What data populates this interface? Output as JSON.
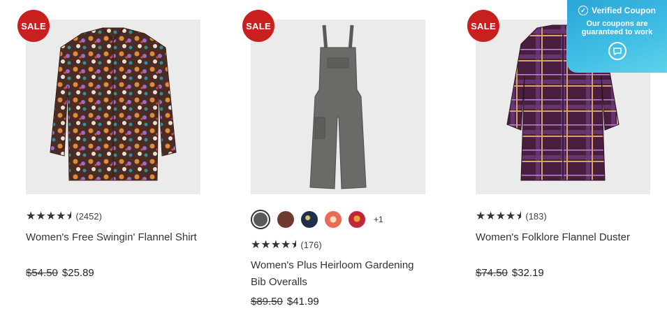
{
  "badges": {
    "sale": "SALE"
  },
  "products": [
    {
      "rating_count": "(2452)",
      "title": "Women's Free Swingin' Flannel Shirt",
      "old_price": "$54.50",
      "price": "$25.89"
    },
    {
      "rating_count": "(176)",
      "title_line1": "Women's Plus Heirloom Gardening",
      "title_line2": "Bib Overalls",
      "old_price": "$89.50",
      "price": "$41.99",
      "swatches": [
        "#5a5a58",
        "#6e3a2e",
        "#1f2f4a",
        "#e96b55",
        "#c0283a"
      ],
      "more_swatches": "+1"
    },
    {
      "rating_count": "(183)",
      "title": "Women's Folklore Flannel Duster",
      "old_price": "$74.50",
      "price": "$32.19"
    }
  ],
  "coupon": {
    "heading": "Verified Coupon",
    "line1": "Our coupons are",
    "line2": "guaranteed to work"
  },
  "colors": {
    "sale_badge": "#c8201e",
    "coupon_bg": "#2aa6d6"
  }
}
